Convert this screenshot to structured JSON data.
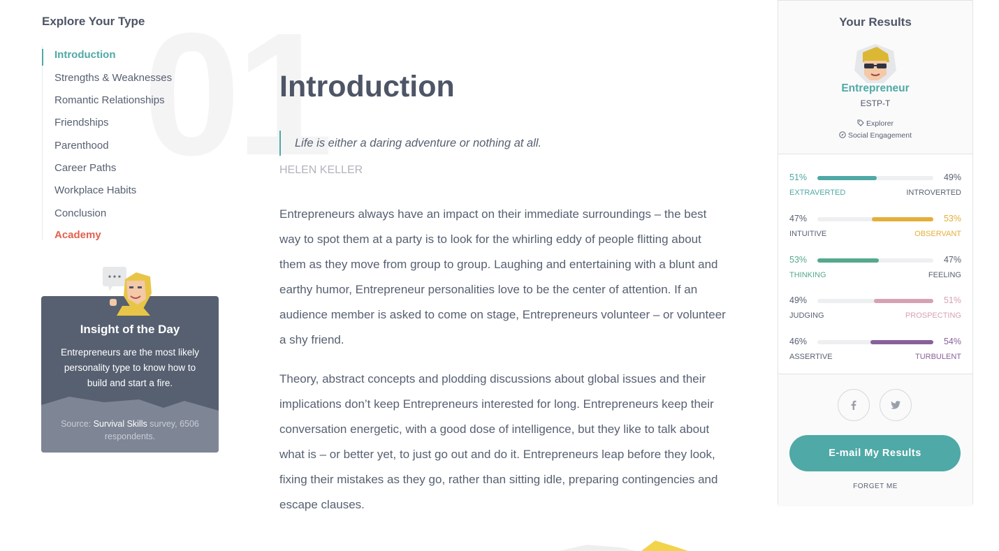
{
  "sidebar": {
    "title": "Explore Your Type",
    "items": [
      {
        "label": "Introduction"
      },
      {
        "label": "Strengths & Weaknesses"
      },
      {
        "label": "Romantic Relationships"
      },
      {
        "label": "Friendships"
      },
      {
        "label": "Parenthood"
      },
      {
        "label": "Career Paths"
      },
      {
        "label": "Workplace Habits"
      },
      {
        "label": "Conclusion"
      },
      {
        "label": "Academy"
      }
    ],
    "active_item": "Introduction"
  },
  "section_number": "01",
  "insight": {
    "title": "Insight of the Day",
    "text": "Entrepreneurs are the most likely personality type to know how to build and start a fire.",
    "source_prefix": "Source: ",
    "source_link": "Survival Skills",
    "source_suffix": " survey, 6506 respondents."
  },
  "main": {
    "title": "Introduction",
    "quote": "Life is either a daring adventure or nothing at all.",
    "quote_author": "HELEN KELLER",
    "paragraphs": [
      "Entrepreneurs always have an impact on their immediate surroundings – the best way to spot them at a party is to look for the whirling eddy of people flitting about them as they move from group to group. Laughing and entertaining with a blunt and earthy humor, Entrepreneur personalities love to be the center of attention. If an audience member is asked to come on stage, Entrepreneurs volunteer – or volunteer a shy friend.",
      "Theory, abstract concepts and plodding discussions about global issues and their implications don’t keep Entrepreneurs interested for long. Entrepreneurs keep their conversation energetic, with a good dose of intelligence, but they like to talk about what is – or better yet, to just go out and do it. Entrepreneurs leap before they look, fixing their mistakes as they go, rather than sitting idle, preparing contingencies and escape clauses."
    ]
  },
  "results": {
    "title": "Your Results",
    "type_name": "Entrepreneur",
    "type_code": "ESTP-T",
    "role": "Explorer",
    "strategy": "Social Engagement",
    "traits": [
      {
        "left_pct": "51%",
        "right_pct": "49%",
        "left_label": "Extraverted",
        "right_label": "Introverted",
        "dominant": "left",
        "value": 51,
        "color": "#4fa9a6"
      },
      {
        "left_pct": "47%",
        "right_pct": "53%",
        "left_label": "Intuitive",
        "right_label": "Observant",
        "dominant": "right",
        "value": 53,
        "color": "#e4ae3a"
      },
      {
        "left_pct": "53%",
        "right_pct": "47%",
        "left_label": "Thinking",
        "right_label": "Feeling",
        "dominant": "left",
        "value": 53,
        "color": "#56a88e"
      },
      {
        "left_pct": "49%",
        "right_pct": "51%",
        "left_label": "Judging",
        "right_label": "Prospecting",
        "dominant": "right",
        "value": 51,
        "color": "#d7a1b4"
      },
      {
        "left_pct": "46%",
        "right_pct": "54%",
        "left_label": "Assertive",
        "right_label": "Turbulent",
        "dominant": "right",
        "value": 54,
        "color": "#88619a"
      }
    ],
    "email_button": "E-mail My Results",
    "forget_link": "FORGET ME"
  },
  "colors": {
    "accent": "#4fa9a6",
    "academy": "#e2604f",
    "card": "#576071"
  }
}
